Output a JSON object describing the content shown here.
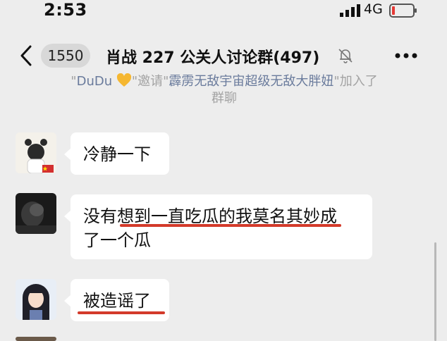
{
  "status_bar": {
    "time": "2:53",
    "network": "4G"
  },
  "header": {
    "unread_count": "1550",
    "title": "肖战 227 公关人讨论群(497)"
  },
  "system_notice": {
    "quote_open_1": "\"",
    "inviter": "DuDu",
    "quote_close_1": "\"",
    "verb": "邀请",
    "quote_open_2": "\"",
    "invitee": "霹雳无敌宇宙超级无敌大胖妞",
    "tail": "\"加入了",
    "line2": "群聊"
  },
  "messages": [
    {
      "text": "冷静一下"
    },
    {
      "line1": "没有想到一直吃瓜的我莫名其妙成",
      "line2": "了一个瓜"
    },
    {
      "text": "被造谣了"
    }
  ],
  "colors": {
    "background": "#ededed",
    "bubble": "#ffffff",
    "underline": "#d33a2a",
    "notice_text": "#a3a3a3",
    "notice_name": "#6a7b9c"
  }
}
